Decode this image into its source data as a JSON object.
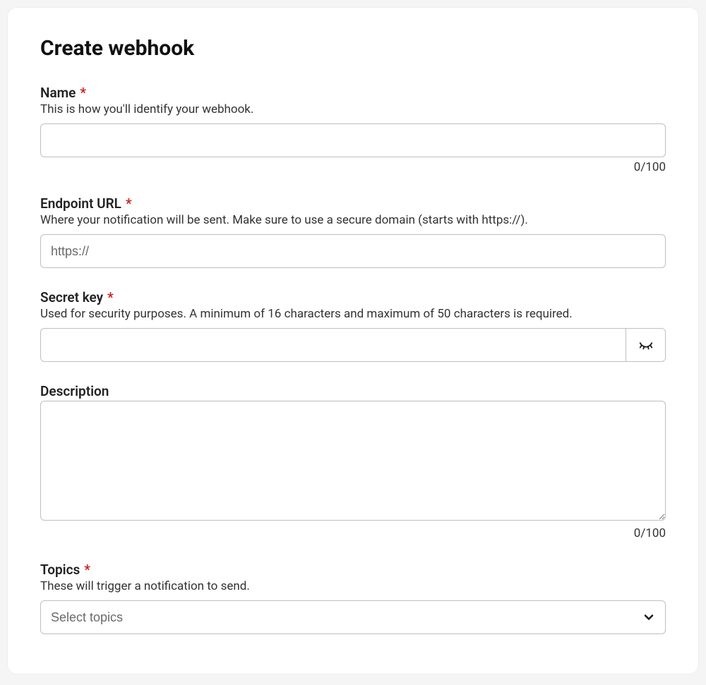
{
  "title": "Create webhook",
  "required_mark": "*",
  "fields": {
    "name": {
      "label": "Name",
      "help": "This is how you'll identify your webhook.",
      "value": "",
      "counter": "0/100"
    },
    "endpoint": {
      "label": "Endpoint URL",
      "help": "Where your notification will be sent. Make sure to use a secure domain (starts with https://).",
      "placeholder": "https://",
      "value": ""
    },
    "secret": {
      "label": "Secret key",
      "help": "Used for security purposes. A minimum of 16 characters and maximum of 50 characters is required.",
      "value": ""
    },
    "description": {
      "label": "Description",
      "value": "",
      "counter": "0/100"
    },
    "topics": {
      "label": "Topics",
      "help": "These will trigger a notification to send.",
      "placeholder": "Select topics"
    }
  }
}
